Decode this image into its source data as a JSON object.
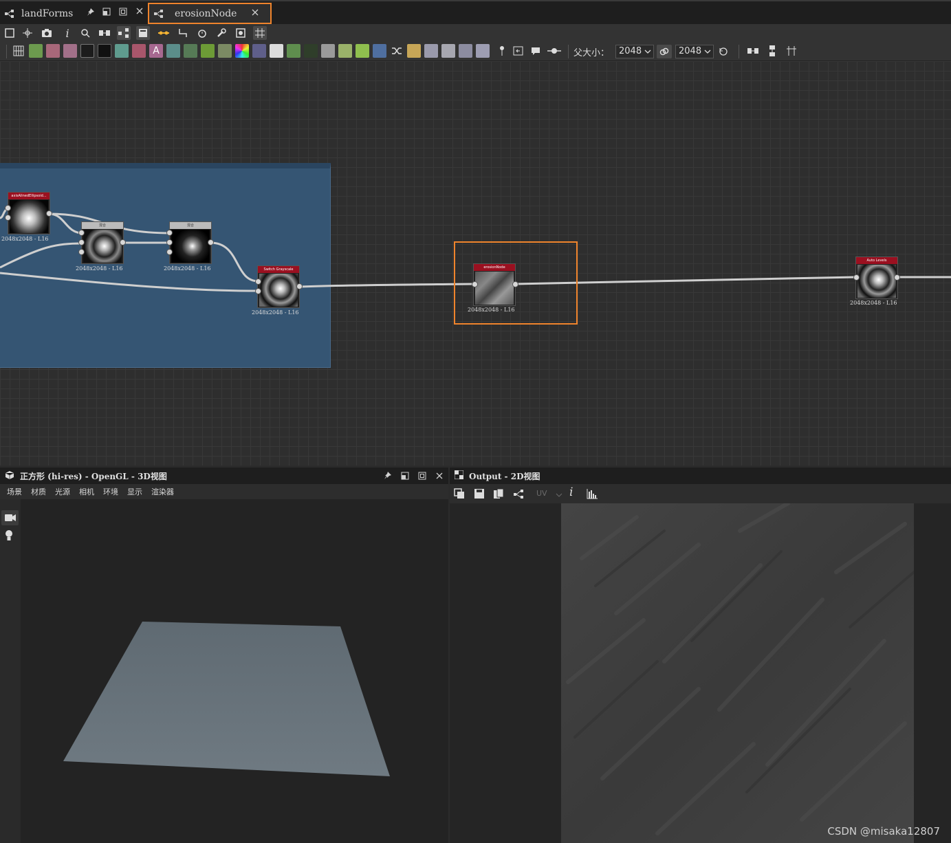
{
  "tabs": [
    {
      "label": "landForms",
      "icon": "graph-icon",
      "active": false
    },
    {
      "label": "erosionNode",
      "icon": "graph-icon",
      "active": true
    }
  ],
  "toolbar": {
    "parent_size_label": "父大小：",
    "width_value": "2048",
    "height_value": "2048"
  },
  "nodes": [
    {
      "title": "axisAlinedEllipsoid...",
      "label": "2048x2048 - L16"
    },
    {
      "title": "混合",
      "label": "2048x2048 - L16"
    },
    {
      "title": "混合",
      "label": "2048x2048 - L16"
    },
    {
      "title": "Switch Grayscale",
      "label": "2048x2048 - L16"
    },
    {
      "title": "erosionNode",
      "label": "2048x2048 - L16"
    },
    {
      "title": "Auto Levels",
      "label": "2048x2048 - L16"
    }
  ],
  "pane3d": {
    "title": "正方形 (hi-res) - OpenGL - 3D视图",
    "menu": [
      "场景",
      "材质",
      "光源",
      "相机",
      "环境",
      "显示",
      "渲染器"
    ]
  },
  "pane2d": {
    "title": "Output - 2D视图",
    "uv_label": "UV"
  },
  "watermark": "CSDN @misaka12807",
  "colors": {
    "accent_highlight": "#f0842c",
    "frame_blue": "#355573",
    "node_header_red": "#9a1020",
    "canvas_bg": "#2e2e2e"
  }
}
